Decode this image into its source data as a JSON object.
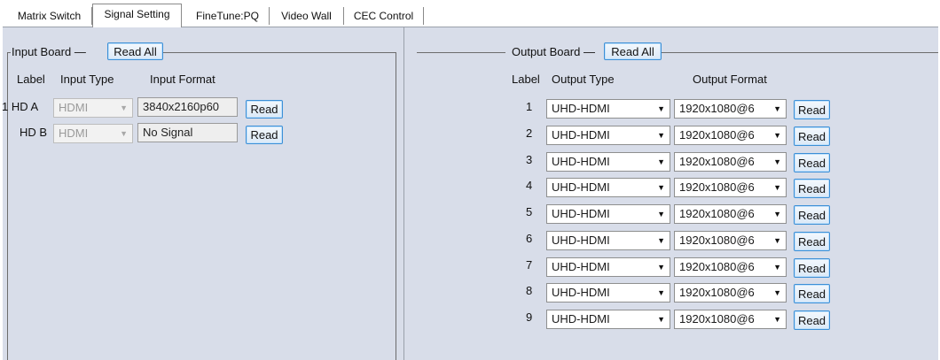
{
  "tabs": [
    {
      "label": "Matrix Switch"
    },
    {
      "label": "Signal Setting"
    },
    {
      "label": "FineTune:PQ"
    },
    {
      "label": "Video Wall"
    },
    {
      "label": "CEC Control"
    }
  ],
  "active_tab": "Signal Setting",
  "input_board": {
    "title": "Input Board",
    "read_all_label": "Read All",
    "headers": {
      "label": "Label",
      "type": "Input Type",
      "format": "Input Format"
    },
    "rows": [
      {
        "label": "1 HD A",
        "type": "HDMI",
        "format": "3840x2160p60",
        "read_label": "Read"
      },
      {
        "label": "HD B",
        "type": "HDMI",
        "format": "No Signal",
        "read_label": "Read"
      }
    ]
  },
  "output_board": {
    "title": "Output Board",
    "read_all_label": "Read All",
    "headers": {
      "label": "Label",
      "type": "Output Type",
      "format": "Output Format"
    },
    "rows": [
      {
        "label": "1",
        "type": "UHD-HDMI",
        "format": "1920x1080@6",
        "read_label": "Read"
      },
      {
        "label": "2",
        "type": "UHD-HDMI",
        "format": "1920x1080@6",
        "read_label": "Read"
      },
      {
        "label": "3",
        "type": "UHD-HDMI",
        "format": "1920x1080@6",
        "read_label": "Read"
      },
      {
        "label": "4",
        "type": "UHD-HDMI",
        "format": "1920x1080@6",
        "read_label": "Read"
      },
      {
        "label": "5",
        "type": "UHD-HDMI",
        "format": "1920x1080@6",
        "read_label": "Read"
      },
      {
        "label": "6",
        "type": "UHD-HDMI",
        "format": "1920x1080@6",
        "read_label": "Read"
      },
      {
        "label": "7",
        "type": "UHD-HDMI",
        "format": "1920x1080@6",
        "read_label": "Read"
      },
      {
        "label": "8",
        "type": "UHD-HDMI",
        "format": "1920x1080@6",
        "read_label": "Read"
      },
      {
        "label": "9",
        "type": "UHD-HDMI",
        "format": "1920x1080@6",
        "read_label": "Read"
      }
    ]
  },
  "icons": {
    "dropdown": "chevron-down-icon"
  },
  "colors": {
    "panel_bg": "#d8dde9",
    "button_border": "#3c8fd6",
    "disabled_text": "#9a9a9a"
  }
}
